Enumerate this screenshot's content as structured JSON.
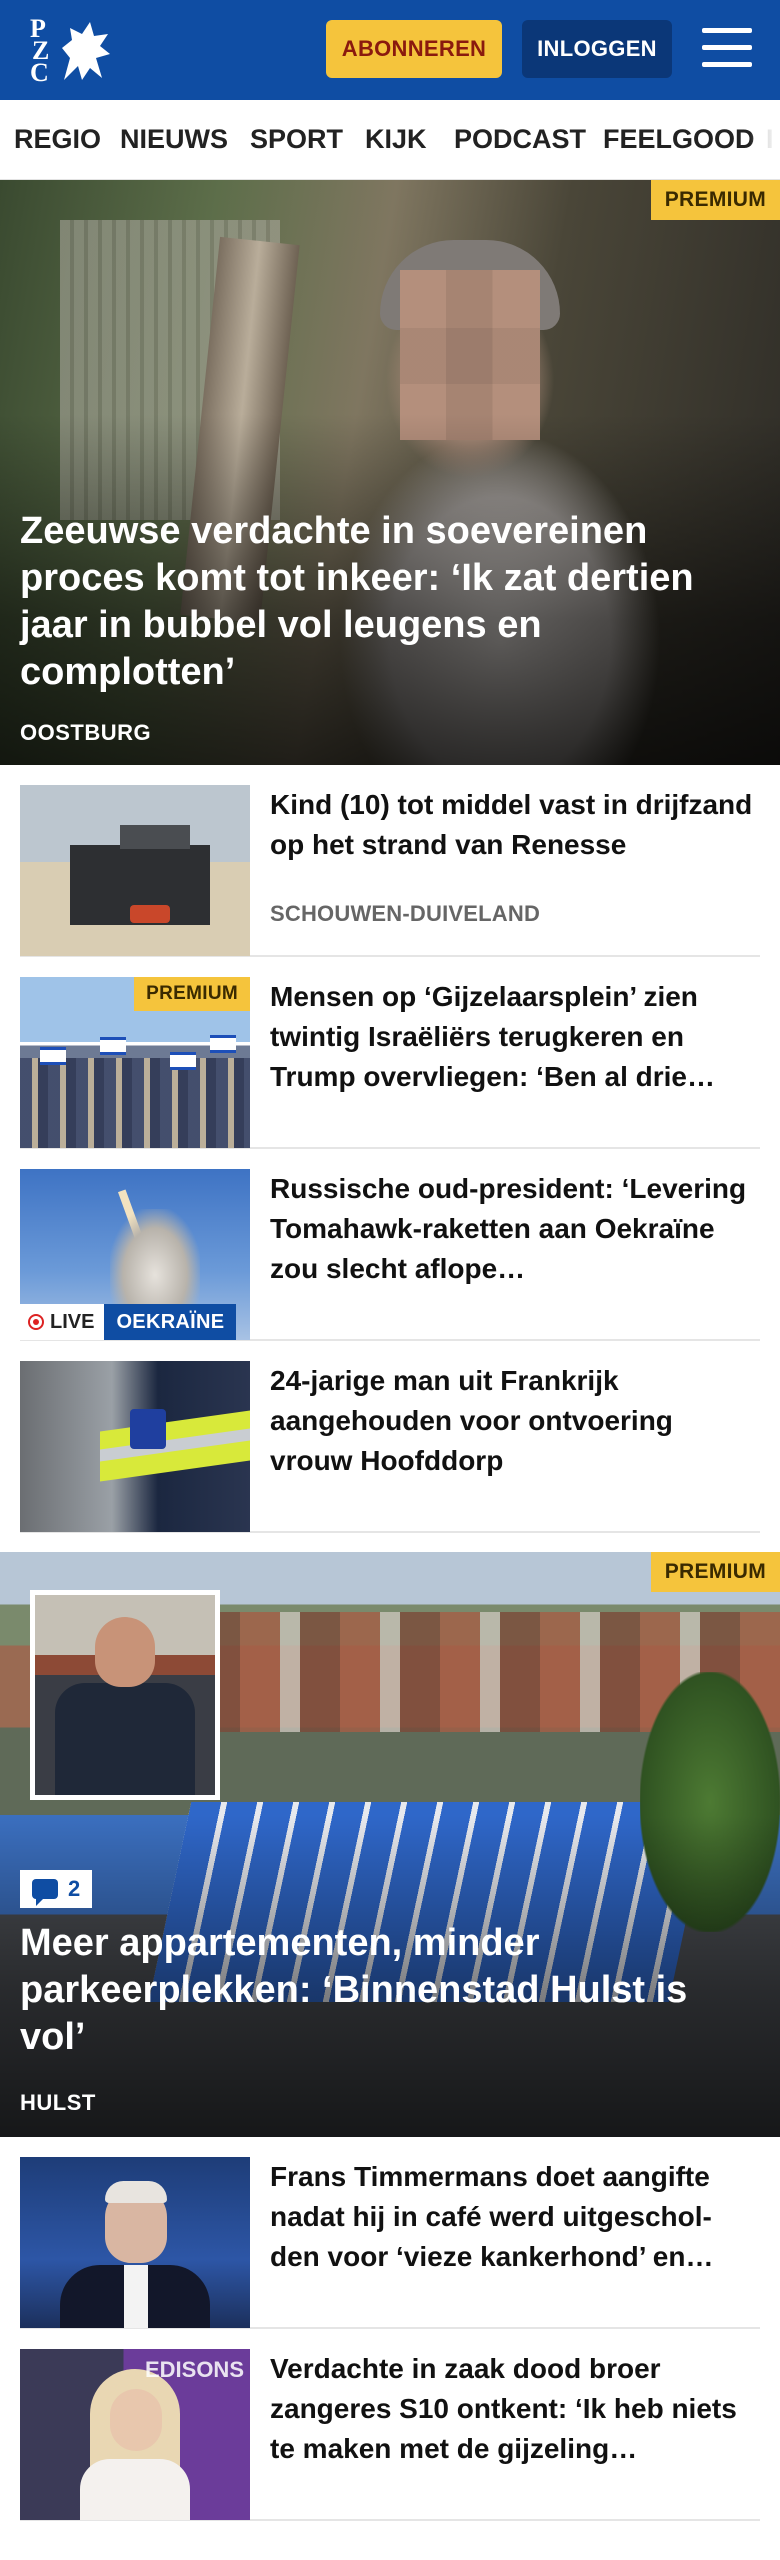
{
  "header": {
    "subscribe_label": "ABONNEREN",
    "login_label": "INLOGGEN",
    "logo_letters": [
      "P",
      "Z",
      "C"
    ]
  },
  "nav": {
    "items": [
      "REGIO",
      "NIEUWS",
      "SPORT",
      "KIJK",
      "PODCAST",
      "FEELGOOD",
      "I"
    ]
  },
  "hero": {
    "badge": "PREMIUM",
    "title": "Zeeuwse verdachte in soevereinen proces komt tot inkeer: ‘Ik zat dertien jaar in bubbel vol leugens en complotten’",
    "location": "OOSTBURG"
  },
  "articles": [
    {
      "title": "Kind (10) tot middel vast in drijfzand op het strand van Renesse",
      "location": "SCHOUWEN-DUIVELAND"
    },
    {
      "title": "Mensen op ‘Gijzelaarsplein’ zien twintig Israëliërs terugkeren en Trump overvliegen: ‘Ben al drie…",
      "badge": "PREMIUM"
    },
    {
      "title": "Russische oud-president: ‘Levering Tomahawk-raketten aan Oekraïne zou slecht aflope…",
      "live_label": "LIVE",
      "tag": "OEKRAÏNE"
    },
    {
      "title": "24-jarige man uit Frankrijk aangehouden voor ontvoering vrouw Hoofddorp"
    }
  ],
  "feature": {
    "badge": "PREMIUM",
    "comment_count": "2",
    "title": "Meer appartementen, minder parkeerplekken: ‘Binnenstad Hulst is vol’",
    "location": "HULST"
  },
  "articles2": [
    {
      "title": "Frans Timmermans doet aangifte nadat hij in café werd uitgeschol-den voor ‘vieze kankerhond’ en…"
    },
    {
      "title": "Verdachte in zaak dood broer zangeres S10 ontkent: ‘Ik heb niets te maken met de gijzeling…",
      "backdrop_text": "EDISONS"
    }
  ],
  "colors": {
    "brand_blue": "#0f4da3",
    "premium_yellow": "#f5c43c",
    "login_dark_blue": "#0b3778"
  }
}
